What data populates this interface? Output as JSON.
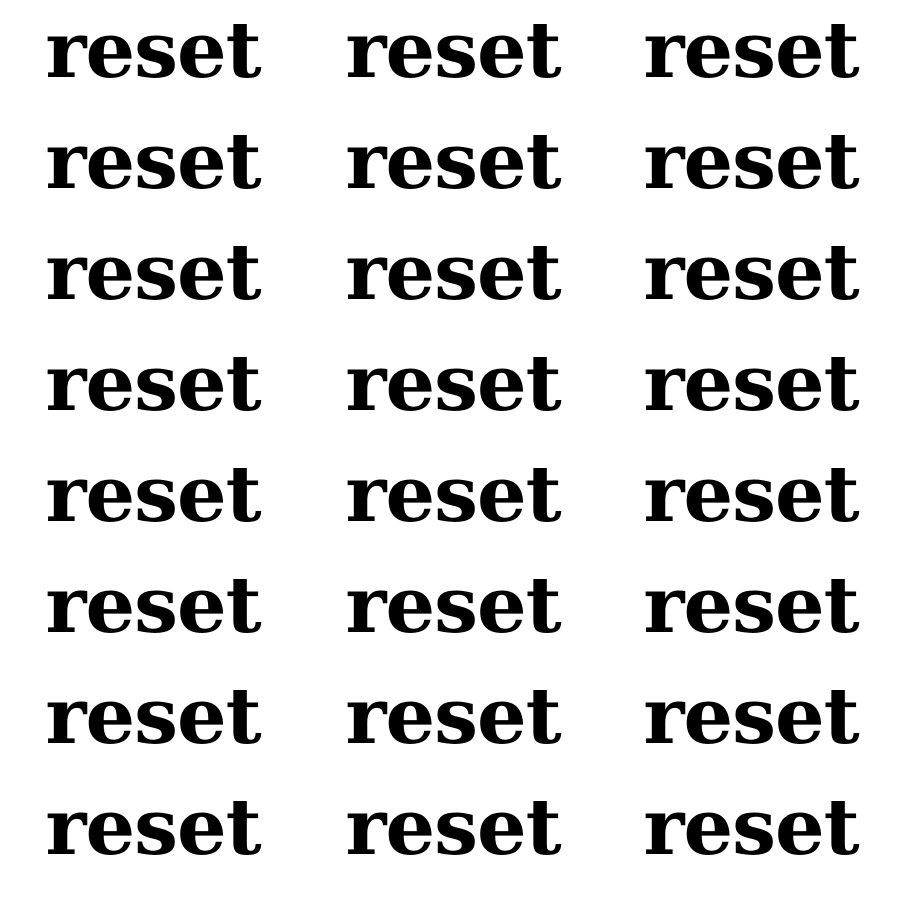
{
  "words": [
    [
      "reset",
      "reset",
      "reset"
    ],
    [
      "reset",
      "reset",
      "reset"
    ],
    [
      "reset",
      "reset",
      "reset"
    ],
    [
      "reset",
      "reset",
      "reset"
    ],
    [
      "reset",
      "reset",
      "reset"
    ],
    [
      "reset",
      "reset",
      "reset"
    ],
    [
      "reset",
      "reset",
      "reset"
    ],
    [
      "reset",
      "reset",
      "reset"
    ]
  ],
  "colors": {
    "text": "#000000",
    "background": "#ffffff"
  }
}
